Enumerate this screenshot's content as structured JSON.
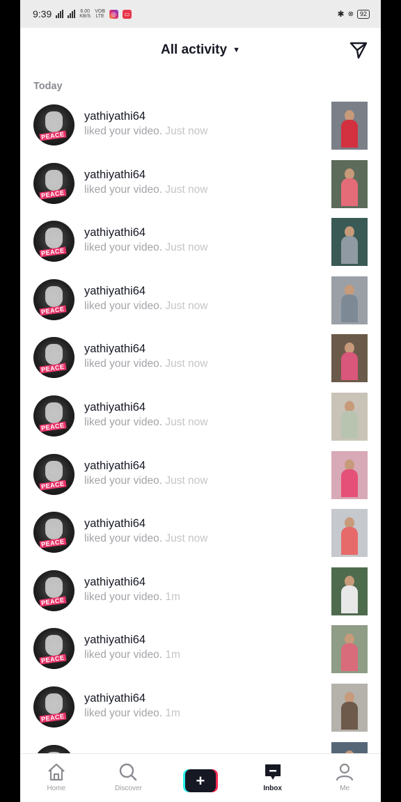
{
  "status_bar": {
    "time": "9:39",
    "net_speed": "6.00",
    "net_unit": "KB/S",
    "volte_top": "VOB",
    "volte_bottom": "LTE",
    "battery": "92"
  },
  "header": {
    "title": "All activity",
    "filter_icon": "send-icon"
  },
  "section": {
    "label": "Today"
  },
  "activities": [
    {
      "username": "yathiyathi64",
      "action": "liked your video.",
      "time": "Just now",
      "thumb_bg": "#7a7f88",
      "thumb_fig": "#d3313f"
    },
    {
      "username": "yathiyathi64",
      "action": "liked your video.",
      "time": "Just now",
      "thumb_bg": "#5d6b5a",
      "thumb_fig": "#e46b78"
    },
    {
      "username": "yathiyathi64",
      "action": "liked your video.",
      "time": "Just now",
      "thumb_bg": "#3a5a55",
      "thumb_fig": "#8f9aa3"
    },
    {
      "username": "yathiyathi64",
      "action": "liked your video.",
      "time": "Just now",
      "thumb_bg": "#9aa0a6",
      "thumb_fig": "#7d8a96"
    },
    {
      "username": "yathiyathi64",
      "action": "liked your video.",
      "time": "Just now",
      "thumb_bg": "#6b5a4a",
      "thumb_fig": "#d9577a"
    },
    {
      "username": "yathiyathi64",
      "action": "liked your video.",
      "time": "Just now",
      "thumb_bg": "#c9c3b7",
      "thumb_fig": "#b8c4b0"
    },
    {
      "username": "yathiyathi64",
      "action": "liked your video.",
      "time": "Just now",
      "thumb_bg": "#d8a9b6",
      "thumb_fig": "#e55078"
    },
    {
      "username": "yathiyathi64",
      "action": "liked your video.",
      "time": "Just now",
      "thumb_bg": "#c5c8cc",
      "thumb_fig": "#e66a6a"
    },
    {
      "username": "yathiyathi64",
      "action": "liked your video.",
      "time": "1m",
      "thumb_bg": "#4e6b4e",
      "thumb_fig": "#e8e8e8"
    },
    {
      "username": "yathiyathi64",
      "action": "liked your video.",
      "time": "1m",
      "thumb_bg": "#8f9c86",
      "thumb_fig": "#d86c7a"
    },
    {
      "username": "yathiyathi64",
      "action": "liked your video.",
      "time": "1m",
      "thumb_bg": "#b4b2ab",
      "thumb_fig": "#6d5a4a"
    },
    {
      "username": "",
      "action": "",
      "time": "",
      "thumb_bg": "#556677",
      "thumb_fig": "#aab2bb"
    }
  ],
  "avatar_badge": "PEACE",
  "bottom_nav": [
    {
      "label": "Home",
      "icon": "home-icon"
    },
    {
      "label": "Discover",
      "icon": "search-icon"
    },
    {
      "label": "",
      "icon": "plus-icon"
    },
    {
      "label": "Inbox",
      "icon": "inbox-icon"
    },
    {
      "label": "Me",
      "icon": "profile-icon"
    }
  ],
  "colors": {
    "accent_cyan": "#25f4ee",
    "accent_red": "#fe2c55",
    "text_primary": "#161823",
    "text_secondary": "#a3a4a8"
  }
}
